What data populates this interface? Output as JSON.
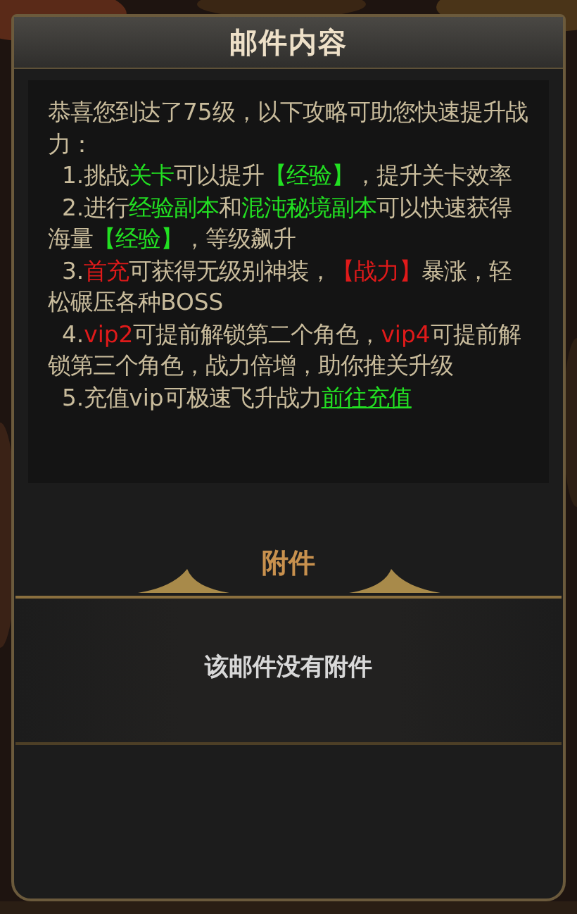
{
  "window": {
    "title": "邮件内容"
  },
  "mail_body": [
    {
      "kind": "intro",
      "segments": [
        {
          "text": "恭喜您到达了75级，以下攻略可助您快速提升战力：",
          "color": "#c9bc9c"
        }
      ]
    },
    {
      "kind": "item",
      "segments": [
        {
          "text": "1.挑战",
          "color": "#c9bc9c"
        },
        {
          "text": "关卡",
          "color": "#22e022"
        },
        {
          "text": "可以提升",
          "color": "#c9bc9c"
        },
        {
          "text": "【经验】",
          "color": "#22e022"
        },
        {
          "text": "，提升关卡效率",
          "color": "#c9bc9c"
        }
      ]
    },
    {
      "kind": "item",
      "segments": [
        {
          "text": "2.进行",
          "color": "#c9bc9c"
        },
        {
          "text": "经验副本",
          "color": "#22e022"
        },
        {
          "text": "和",
          "color": "#c9bc9c"
        },
        {
          "text": "混沌秘境副本",
          "color": "#22e022"
        },
        {
          "text": "可以快速获得海量",
          "color": "#c9bc9c"
        },
        {
          "text": "【经验】",
          "color": "#22e022"
        },
        {
          "text": "，等级飙升",
          "color": "#c9bc9c"
        }
      ]
    },
    {
      "kind": "item",
      "segments": [
        {
          "text": "3.",
          "color": "#c9bc9c"
        },
        {
          "text": "首充",
          "color": "#e01a1a"
        },
        {
          "text": "可获得无级别神装，",
          "color": "#c9bc9c"
        },
        {
          "text": "【战力】",
          "color": "#e01a1a"
        },
        {
          "text": "暴涨，轻松碾压各种BOSS",
          "color": "#c9bc9c"
        }
      ]
    },
    {
      "kind": "item",
      "segments": [
        {
          "text": "4.",
          "color": "#c9bc9c"
        },
        {
          "text": "vip2",
          "color": "#e01a1a"
        },
        {
          "text": "可提前解锁第二个角色，",
          "color": "#c9bc9c"
        },
        {
          "text": "vip4",
          "color": "#e01a1a"
        },
        {
          "text": "可提前解锁第三个角色，战力倍增，助你推关升级",
          "color": "#c9bc9c"
        }
      ]
    },
    {
      "kind": "item",
      "segments": [
        {
          "text": "5.充值vip可极速飞升战力",
          "color": "#c9bc9c"
        },
        {
          "text": "前往充值",
          "color": "#22e022",
          "kind": "link"
        }
      ]
    }
  ],
  "attachments": {
    "title": "附件",
    "empty_message": "该邮件没有附件"
  }
}
